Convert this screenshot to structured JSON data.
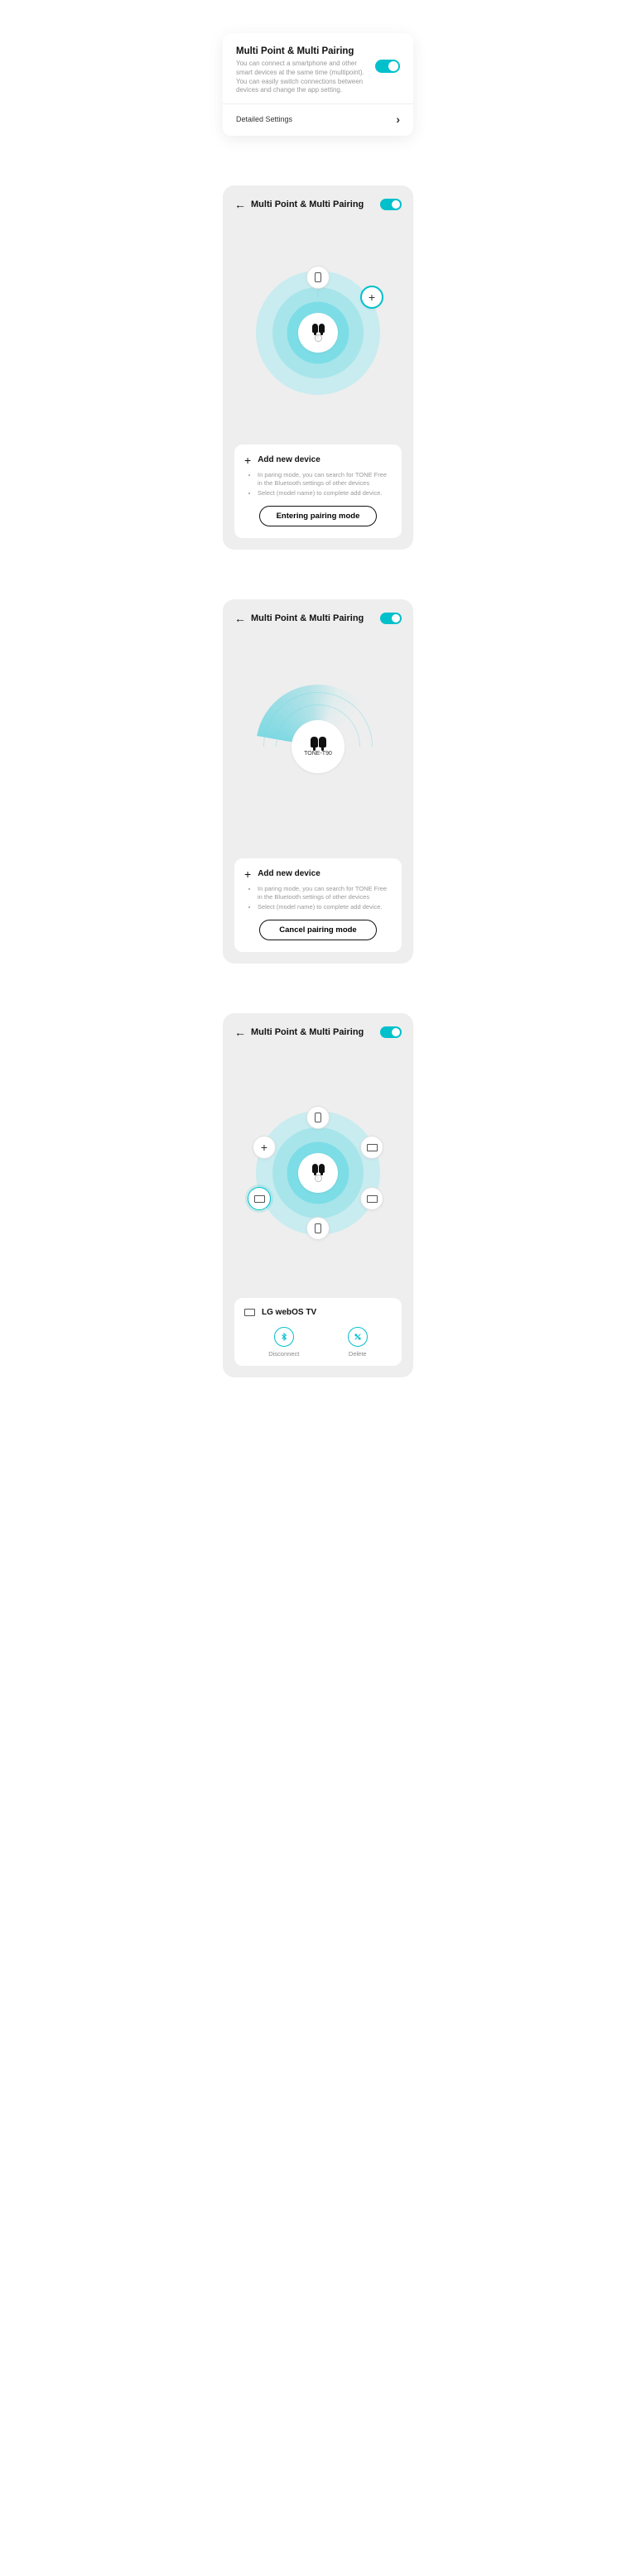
{
  "card1": {
    "title": "Multi Point & Multi Pairing",
    "desc": "You can connect a smartphone and other smart devices at the same time (multipoint). You can easily switch connections between devices and change the app setting.",
    "detail_label": "Detailed Settings"
  },
  "panel_shared": {
    "title": "Multi Point & Multi Pairing"
  },
  "add_card": {
    "title": "Add new device",
    "bullet1": "In paring mode, you can search for TONE Free in the Bluetooth settings of other devices",
    "bullet2": "Select (model name) to complete add device."
  },
  "panel1": {
    "button": "Entering pairing mode"
  },
  "panel2": {
    "device_label": "TONE-T90",
    "button": "Cancel pairing mode"
  },
  "panel3": {
    "selected_device": "LG webOS TV",
    "disconnect": "Disconnect",
    "delete": "Delete"
  }
}
